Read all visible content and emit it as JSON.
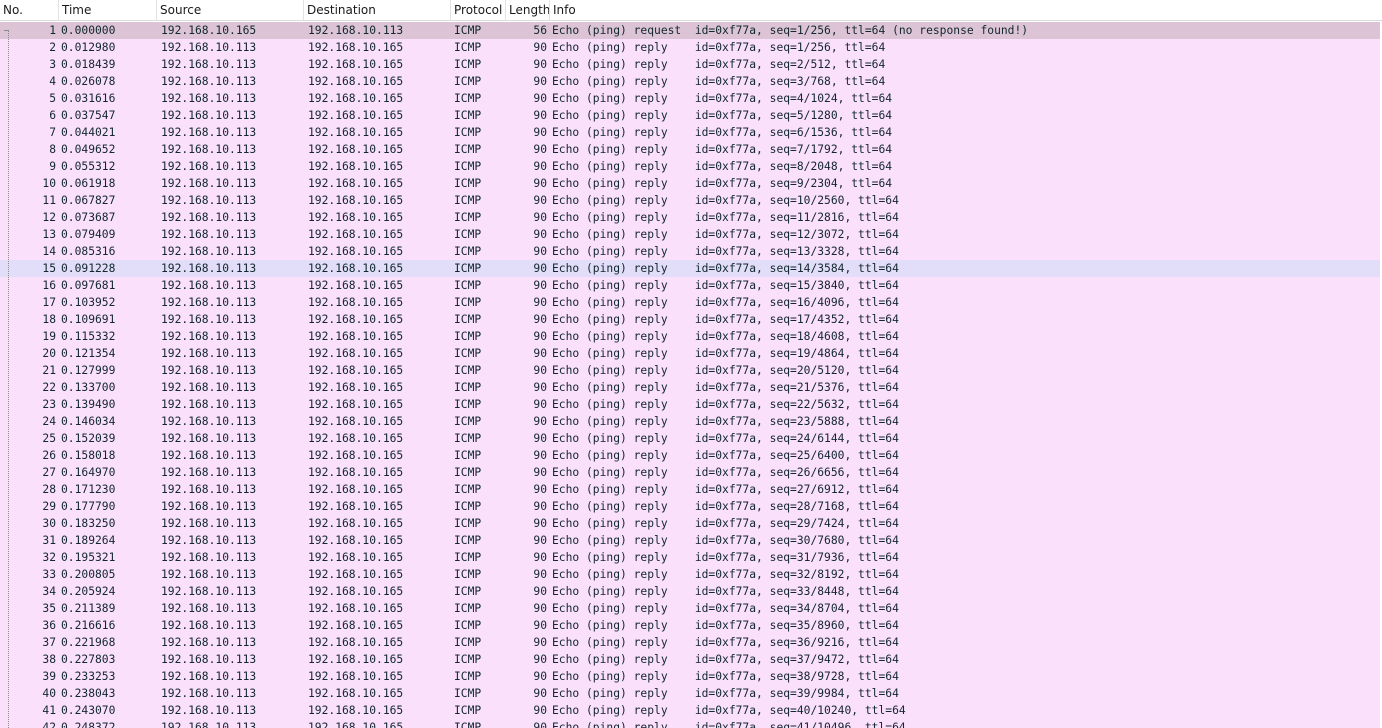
{
  "columns": {
    "no": "No.",
    "time": "Time",
    "source": "Source",
    "destination": "Destination",
    "protocol": "Protocol",
    "length": "Length",
    "info": "Info"
  },
  "colors": {
    "row_bg": "#fbe0fc",
    "request_bg": "#dcc4d6",
    "selected_bg": "#e2ddf8",
    "text": "#12272e"
  },
  "packets": [
    {
      "no": "1",
      "time": "0.000000",
      "src": "192.168.10.165",
      "dst": "192.168.10.113",
      "proto": "ICMP",
      "len": "56",
      "info": "Echo (ping) request  id=0xf77a, seq=1/256, ttl=64 (no response found!)",
      "state": "request"
    },
    {
      "no": "2",
      "time": "0.012980",
      "src": "192.168.10.113",
      "dst": "192.168.10.165",
      "proto": "ICMP",
      "len": "90",
      "info": "Echo (ping) reply    id=0xf77a, seq=1/256, ttl=64"
    },
    {
      "no": "3",
      "time": "0.018439",
      "src": "192.168.10.113",
      "dst": "192.168.10.165",
      "proto": "ICMP",
      "len": "90",
      "info": "Echo (ping) reply    id=0xf77a, seq=2/512, ttl=64"
    },
    {
      "no": "4",
      "time": "0.026078",
      "src": "192.168.10.113",
      "dst": "192.168.10.165",
      "proto": "ICMP",
      "len": "90",
      "info": "Echo (ping) reply    id=0xf77a, seq=3/768, ttl=64"
    },
    {
      "no": "5",
      "time": "0.031616",
      "src": "192.168.10.113",
      "dst": "192.168.10.165",
      "proto": "ICMP",
      "len": "90",
      "info": "Echo (ping) reply    id=0xf77a, seq=4/1024, ttl=64"
    },
    {
      "no": "6",
      "time": "0.037547",
      "src": "192.168.10.113",
      "dst": "192.168.10.165",
      "proto": "ICMP",
      "len": "90",
      "info": "Echo (ping) reply    id=0xf77a, seq=5/1280, ttl=64"
    },
    {
      "no": "7",
      "time": "0.044021",
      "src": "192.168.10.113",
      "dst": "192.168.10.165",
      "proto": "ICMP",
      "len": "90",
      "info": "Echo (ping) reply    id=0xf77a, seq=6/1536, ttl=64"
    },
    {
      "no": "8",
      "time": "0.049652",
      "src": "192.168.10.113",
      "dst": "192.168.10.165",
      "proto": "ICMP",
      "len": "90",
      "info": "Echo (ping) reply    id=0xf77a, seq=7/1792, ttl=64"
    },
    {
      "no": "9",
      "time": "0.055312",
      "src": "192.168.10.113",
      "dst": "192.168.10.165",
      "proto": "ICMP",
      "len": "90",
      "info": "Echo (ping) reply    id=0xf77a, seq=8/2048, ttl=64"
    },
    {
      "no": "10",
      "time": "0.061918",
      "src": "192.168.10.113",
      "dst": "192.168.10.165",
      "proto": "ICMP",
      "len": "90",
      "info": "Echo (ping) reply    id=0xf77a, seq=9/2304, ttl=64"
    },
    {
      "no": "11",
      "time": "0.067827",
      "src": "192.168.10.113",
      "dst": "192.168.10.165",
      "proto": "ICMP",
      "len": "90",
      "info": "Echo (ping) reply    id=0xf77a, seq=10/2560, ttl=64"
    },
    {
      "no": "12",
      "time": "0.073687",
      "src": "192.168.10.113",
      "dst": "192.168.10.165",
      "proto": "ICMP",
      "len": "90",
      "info": "Echo (ping) reply    id=0xf77a, seq=11/2816, ttl=64"
    },
    {
      "no": "13",
      "time": "0.079409",
      "src": "192.168.10.113",
      "dst": "192.168.10.165",
      "proto": "ICMP",
      "len": "90",
      "info": "Echo (ping) reply    id=0xf77a, seq=12/3072, ttl=64"
    },
    {
      "no": "14",
      "time": "0.085316",
      "src": "192.168.10.113",
      "dst": "192.168.10.165",
      "proto": "ICMP",
      "len": "90",
      "info": "Echo (ping) reply    id=0xf77a, seq=13/3328, ttl=64"
    },
    {
      "no": "15",
      "time": "0.091228",
      "src": "192.168.10.113",
      "dst": "192.168.10.165",
      "proto": "ICMP",
      "len": "90",
      "info": "Echo (ping) reply    id=0xf77a, seq=14/3584, ttl=64",
      "state": "selected"
    },
    {
      "no": "16",
      "time": "0.097681",
      "src": "192.168.10.113",
      "dst": "192.168.10.165",
      "proto": "ICMP",
      "len": "90",
      "info": "Echo (ping) reply    id=0xf77a, seq=15/3840, ttl=64"
    },
    {
      "no": "17",
      "time": "0.103952",
      "src": "192.168.10.113",
      "dst": "192.168.10.165",
      "proto": "ICMP",
      "len": "90",
      "info": "Echo (ping) reply    id=0xf77a, seq=16/4096, ttl=64"
    },
    {
      "no": "18",
      "time": "0.109691",
      "src": "192.168.10.113",
      "dst": "192.168.10.165",
      "proto": "ICMP",
      "len": "90",
      "info": "Echo (ping) reply    id=0xf77a, seq=17/4352, ttl=64"
    },
    {
      "no": "19",
      "time": "0.115332",
      "src": "192.168.10.113",
      "dst": "192.168.10.165",
      "proto": "ICMP",
      "len": "90",
      "info": "Echo (ping) reply    id=0xf77a, seq=18/4608, ttl=64"
    },
    {
      "no": "20",
      "time": "0.121354",
      "src": "192.168.10.113",
      "dst": "192.168.10.165",
      "proto": "ICMP",
      "len": "90",
      "info": "Echo (ping) reply    id=0xf77a, seq=19/4864, ttl=64"
    },
    {
      "no": "21",
      "time": "0.127999",
      "src": "192.168.10.113",
      "dst": "192.168.10.165",
      "proto": "ICMP",
      "len": "90",
      "info": "Echo (ping) reply    id=0xf77a, seq=20/5120, ttl=64"
    },
    {
      "no": "22",
      "time": "0.133700",
      "src": "192.168.10.113",
      "dst": "192.168.10.165",
      "proto": "ICMP",
      "len": "90",
      "info": "Echo (ping) reply    id=0xf77a, seq=21/5376, ttl=64"
    },
    {
      "no": "23",
      "time": "0.139490",
      "src": "192.168.10.113",
      "dst": "192.168.10.165",
      "proto": "ICMP",
      "len": "90",
      "info": "Echo (ping) reply    id=0xf77a, seq=22/5632, ttl=64"
    },
    {
      "no": "24",
      "time": "0.146034",
      "src": "192.168.10.113",
      "dst": "192.168.10.165",
      "proto": "ICMP",
      "len": "90",
      "info": "Echo (ping) reply    id=0xf77a, seq=23/5888, ttl=64"
    },
    {
      "no": "25",
      "time": "0.152039",
      "src": "192.168.10.113",
      "dst": "192.168.10.165",
      "proto": "ICMP",
      "len": "90",
      "info": "Echo (ping) reply    id=0xf77a, seq=24/6144, ttl=64"
    },
    {
      "no": "26",
      "time": "0.158018",
      "src": "192.168.10.113",
      "dst": "192.168.10.165",
      "proto": "ICMP",
      "len": "90",
      "info": "Echo (ping) reply    id=0xf77a, seq=25/6400, ttl=64"
    },
    {
      "no": "27",
      "time": "0.164970",
      "src": "192.168.10.113",
      "dst": "192.168.10.165",
      "proto": "ICMP",
      "len": "90",
      "info": "Echo (ping) reply    id=0xf77a, seq=26/6656, ttl=64"
    },
    {
      "no": "28",
      "time": "0.171230",
      "src": "192.168.10.113",
      "dst": "192.168.10.165",
      "proto": "ICMP",
      "len": "90",
      "info": "Echo (ping) reply    id=0xf77a, seq=27/6912, ttl=64"
    },
    {
      "no": "29",
      "time": "0.177790",
      "src": "192.168.10.113",
      "dst": "192.168.10.165",
      "proto": "ICMP",
      "len": "90",
      "info": "Echo (ping) reply    id=0xf77a, seq=28/7168, ttl=64"
    },
    {
      "no": "30",
      "time": "0.183250",
      "src": "192.168.10.113",
      "dst": "192.168.10.165",
      "proto": "ICMP",
      "len": "90",
      "info": "Echo (ping) reply    id=0xf77a, seq=29/7424, ttl=64"
    },
    {
      "no": "31",
      "time": "0.189264",
      "src": "192.168.10.113",
      "dst": "192.168.10.165",
      "proto": "ICMP",
      "len": "90",
      "info": "Echo (ping) reply    id=0xf77a, seq=30/7680, ttl=64"
    },
    {
      "no": "32",
      "time": "0.195321",
      "src": "192.168.10.113",
      "dst": "192.168.10.165",
      "proto": "ICMP",
      "len": "90",
      "info": "Echo (ping) reply    id=0xf77a, seq=31/7936, ttl=64"
    },
    {
      "no": "33",
      "time": "0.200805",
      "src": "192.168.10.113",
      "dst": "192.168.10.165",
      "proto": "ICMP",
      "len": "90",
      "info": "Echo (ping) reply    id=0xf77a, seq=32/8192, ttl=64"
    },
    {
      "no": "34",
      "time": "0.205924",
      "src": "192.168.10.113",
      "dst": "192.168.10.165",
      "proto": "ICMP",
      "len": "90",
      "info": "Echo (ping) reply    id=0xf77a, seq=33/8448, ttl=64"
    },
    {
      "no": "35",
      "time": "0.211389",
      "src": "192.168.10.113",
      "dst": "192.168.10.165",
      "proto": "ICMP",
      "len": "90",
      "info": "Echo (ping) reply    id=0xf77a, seq=34/8704, ttl=64"
    },
    {
      "no": "36",
      "time": "0.216616",
      "src": "192.168.10.113",
      "dst": "192.168.10.165",
      "proto": "ICMP",
      "len": "90",
      "info": "Echo (ping) reply    id=0xf77a, seq=35/8960, ttl=64"
    },
    {
      "no": "37",
      "time": "0.221968",
      "src": "192.168.10.113",
      "dst": "192.168.10.165",
      "proto": "ICMP",
      "len": "90",
      "info": "Echo (ping) reply    id=0xf77a, seq=36/9216, ttl=64"
    },
    {
      "no": "38",
      "time": "0.227803",
      "src": "192.168.10.113",
      "dst": "192.168.10.165",
      "proto": "ICMP",
      "len": "90",
      "info": "Echo (ping) reply    id=0xf77a, seq=37/9472, ttl=64"
    },
    {
      "no": "39",
      "time": "0.233253",
      "src": "192.168.10.113",
      "dst": "192.168.10.165",
      "proto": "ICMP",
      "len": "90",
      "info": "Echo (ping) reply    id=0xf77a, seq=38/9728, ttl=64"
    },
    {
      "no": "40",
      "time": "0.238043",
      "src": "192.168.10.113",
      "dst": "192.168.10.165",
      "proto": "ICMP",
      "len": "90",
      "info": "Echo (ping) reply    id=0xf77a, seq=39/9984, ttl=64"
    },
    {
      "no": "41",
      "time": "0.243070",
      "src": "192.168.10.113",
      "dst": "192.168.10.165",
      "proto": "ICMP",
      "len": "90",
      "info": "Echo (ping) reply    id=0xf77a, seq=40/10240, ttl=64"
    },
    {
      "no": "42",
      "time": "0.248372",
      "src": "192.168.10.113",
      "dst": "192.168.10.165",
      "proto": "ICMP",
      "len": "90",
      "info": "Echo (ping) reply    id=0xf77a, seq=41/10496, ttl=64"
    }
  ]
}
